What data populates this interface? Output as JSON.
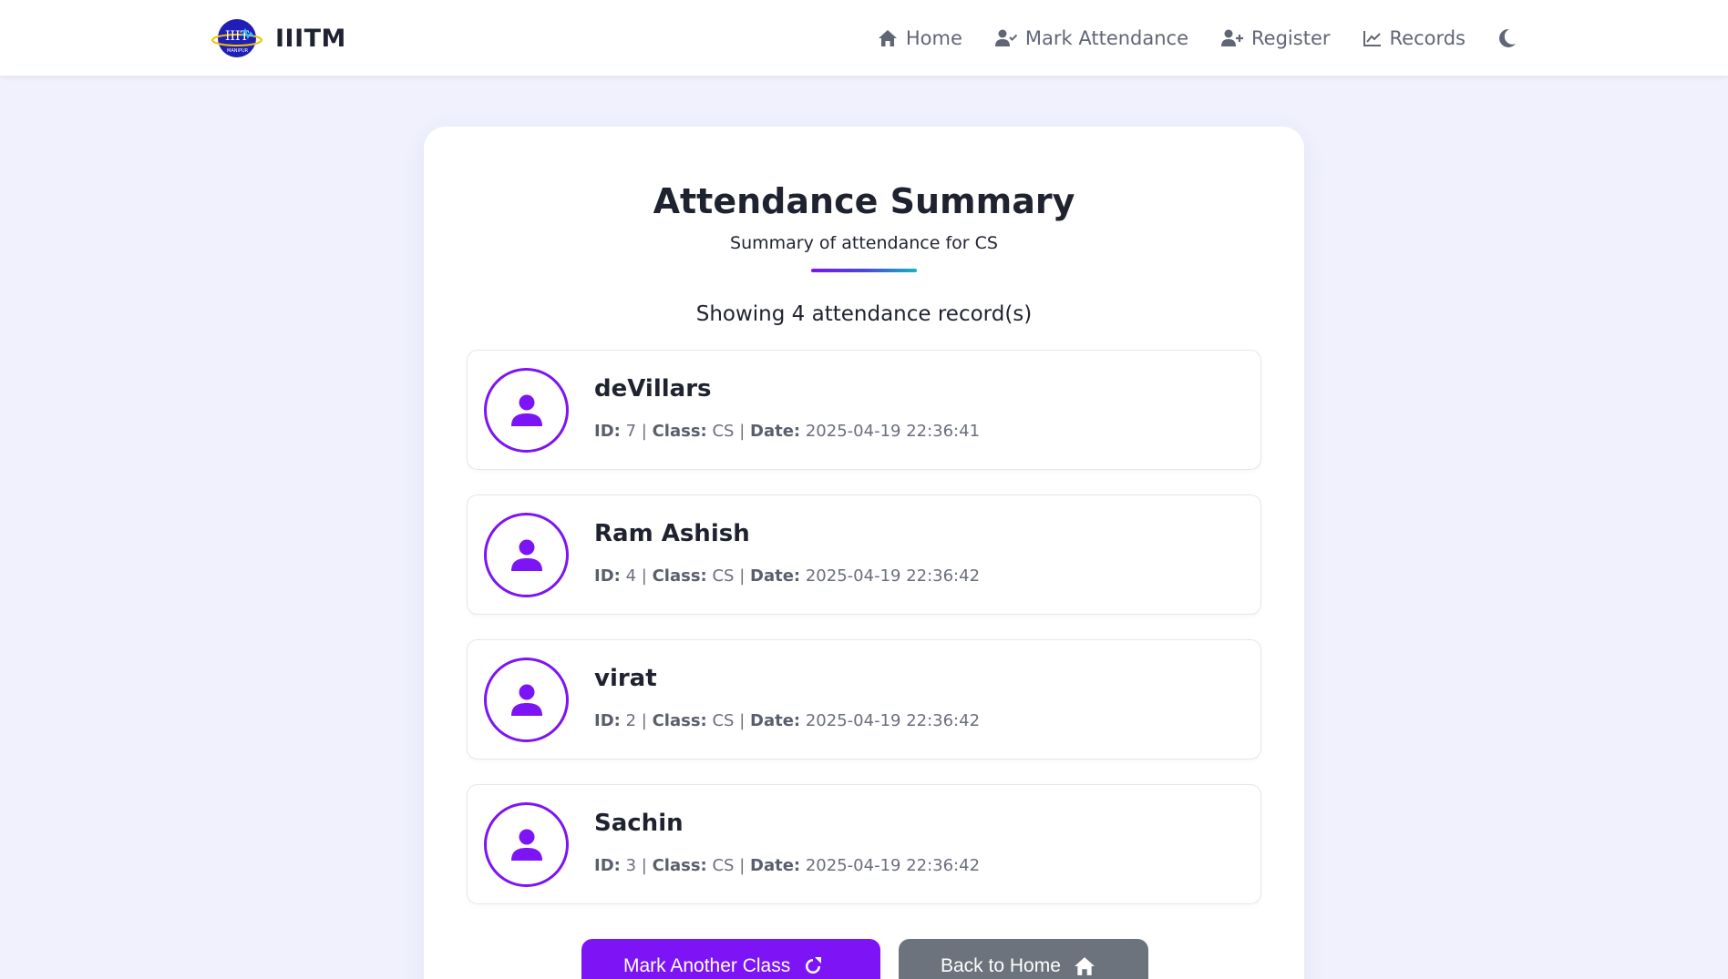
{
  "brand": {
    "name": "IIITM",
    "logo_caption": "MANIPUR",
    "logo_glyph": "IIIT"
  },
  "nav": {
    "items": [
      {
        "label": "Home",
        "icon": "home-icon"
      },
      {
        "label": "Mark Attendance",
        "icon": "user-check-icon"
      },
      {
        "label": "Register",
        "icon": "user-plus-icon"
      },
      {
        "label": "Records",
        "icon": "chart-line-icon"
      }
    ],
    "theme_icon": "moon-icon"
  },
  "summary": {
    "title": "Attendance Summary",
    "subtitle": "Summary of attendance for CS",
    "count_text": "Showing 4 attendance record(s)"
  },
  "labels": {
    "id": "ID:",
    "class": "Class:",
    "date": "Date:",
    "sep": "|"
  },
  "records": [
    {
      "name": "deVillars",
      "id": "7",
      "class": "CS",
      "date": "2025-04-19 22:36:41"
    },
    {
      "name": "Ram Ashish",
      "id": "4",
      "class": "CS",
      "date": "2025-04-19 22:36:42"
    },
    {
      "name": "virat",
      "id": "2",
      "class": "CS",
      "date": "2025-04-19 22:36:42"
    },
    {
      "name": "Sachin",
      "id": "3",
      "class": "CS",
      "date": "2025-04-19 22:36:42"
    }
  ],
  "buttons": {
    "mark_another": "Mark Another Class",
    "back_home": "Back to Home"
  },
  "colors": {
    "accent": "#7c14f5",
    "secondary_button": "#6c737c",
    "background": "#f0f1fd",
    "divider_end": "#12b4c3"
  }
}
